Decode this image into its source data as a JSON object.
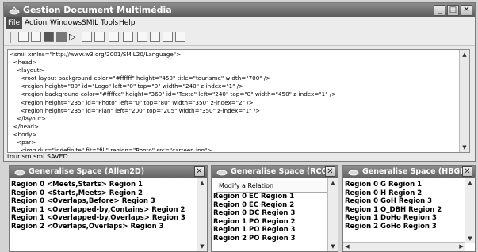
{
  "window": {
    "title": "Gestion Document Multimédia"
  },
  "menu": {
    "items": [
      "File",
      "Action",
      "Windows",
      "SMIL Tools",
      "Help"
    ]
  },
  "toolbar": {
    "icons": [
      "new-file-icon",
      "open-folder-icon",
      "save-icon",
      "save-all-icon",
      "play-icon",
      "layout-icon",
      "satellite-icon",
      "network-icon",
      "export-icon",
      "nav-back-icon",
      "nav-forward-icon",
      "nav-end-icon",
      "refresh-icon"
    ]
  },
  "editor": {
    "lines": [
      "<smil xmlns=\"http://www.w3.org/2001/SMIL20/Language\">",
      "  <head>",
      "    <layout>",
      "      <root-layout background-color=\"#ffffff\" height=\"450\" title=\"tourisme\" width=\"700\" />",
      "      <region height=\"80\" id=\"Logo\" left=\"0\" top=\"0\" width=\"240\" z-index=\"1\" />",
      "      <region background-color=\"#ffffcc\" height=\"360\" id=\"Texte\" left=\"240\" top=\"0\" width=\"450\" z-index=\"1\" />",
      "      <region height=\"235\" id=\"Photo\" left=\"0\" top=\"80\" width=\"350\" z-index=\"2\" />",
      "      <region height=\"235\" id=\"Plan\" left=\"200\" top=\"205\" width=\"350\" z-index=\"1\" />",
      "    </layout>",
      "  </head>",
      "  <body>",
      "    <par>",
      "      <img dur=\"indefinite\" fit=\"fill\" region=\"Photo\" src=\"carteen.jpg\">"
    ],
    "status": "tourism.smi SAVED"
  },
  "panels": {
    "allen": {
      "title": "Generalise Space (Allen2D)",
      "rows": [
        "Region 0 <Meets,Starts> Region 1",
        "Region 0 <Starts,Meets> Region 2",
        "Region 0 <Overlaps,Before> Region 3",
        "Region 1 <Overlapped-by,Contains> Region 2",
        "Region 1 <Overlapped-by,Overlaps> Region 3",
        "Region 2 <Overlaps,Overlaps> Region 3"
      ]
    },
    "rcc": {
      "title": "Generalise Space (RCC)",
      "modify_label": "Modify a Relation",
      "rows": [
        "Region 0 EC Region 1",
        "Region 0 EC Region 2",
        "Region 0 DC Region 3",
        "Region 1 PO Region 2",
        "Region 1 PO Region 3",
        "Region 2 PO Region 3"
      ]
    },
    "hbgd": {
      "title": "Generalise Space (HBGD)",
      "rows": [
        "Region 0 G Region 1",
        "Region 0 H Region 2",
        "Region 0 GoH Region 3",
        "Region 1 O_DBH Region 2",
        "Region 1 DoHo Region 3",
        "Region 2 GoHo Region 3"
      ]
    }
  }
}
